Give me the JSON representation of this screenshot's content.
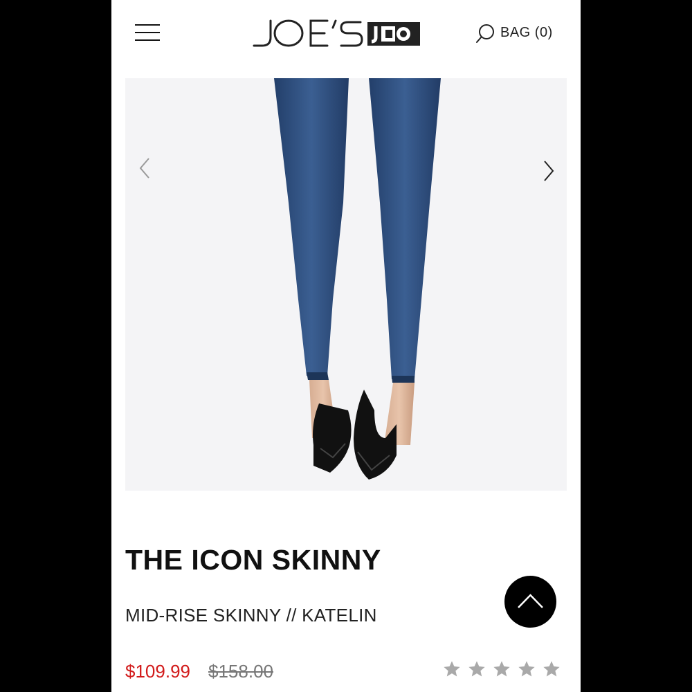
{
  "header": {
    "logo_text": "JOE'S",
    "bag_label": "BAG (0)",
    "icons": {
      "menu": "hamburger-menu-icon",
      "search": "search-icon"
    }
  },
  "product": {
    "title": "THE ICON SKINNY",
    "subtitle": "MID-RISE SKINNY // KATELIN",
    "sale_price": "$109.99",
    "original_price": "$158.00",
    "rating": 0,
    "rating_max": 5
  },
  "gallery": {
    "icons": {
      "prev": "chevron-left-icon",
      "next": "chevron-right-icon"
    }
  },
  "colors": {
    "sale": "#d21a1a",
    "denim": "#2f4f7e",
    "star_empty": "#a9a9a9"
  }
}
